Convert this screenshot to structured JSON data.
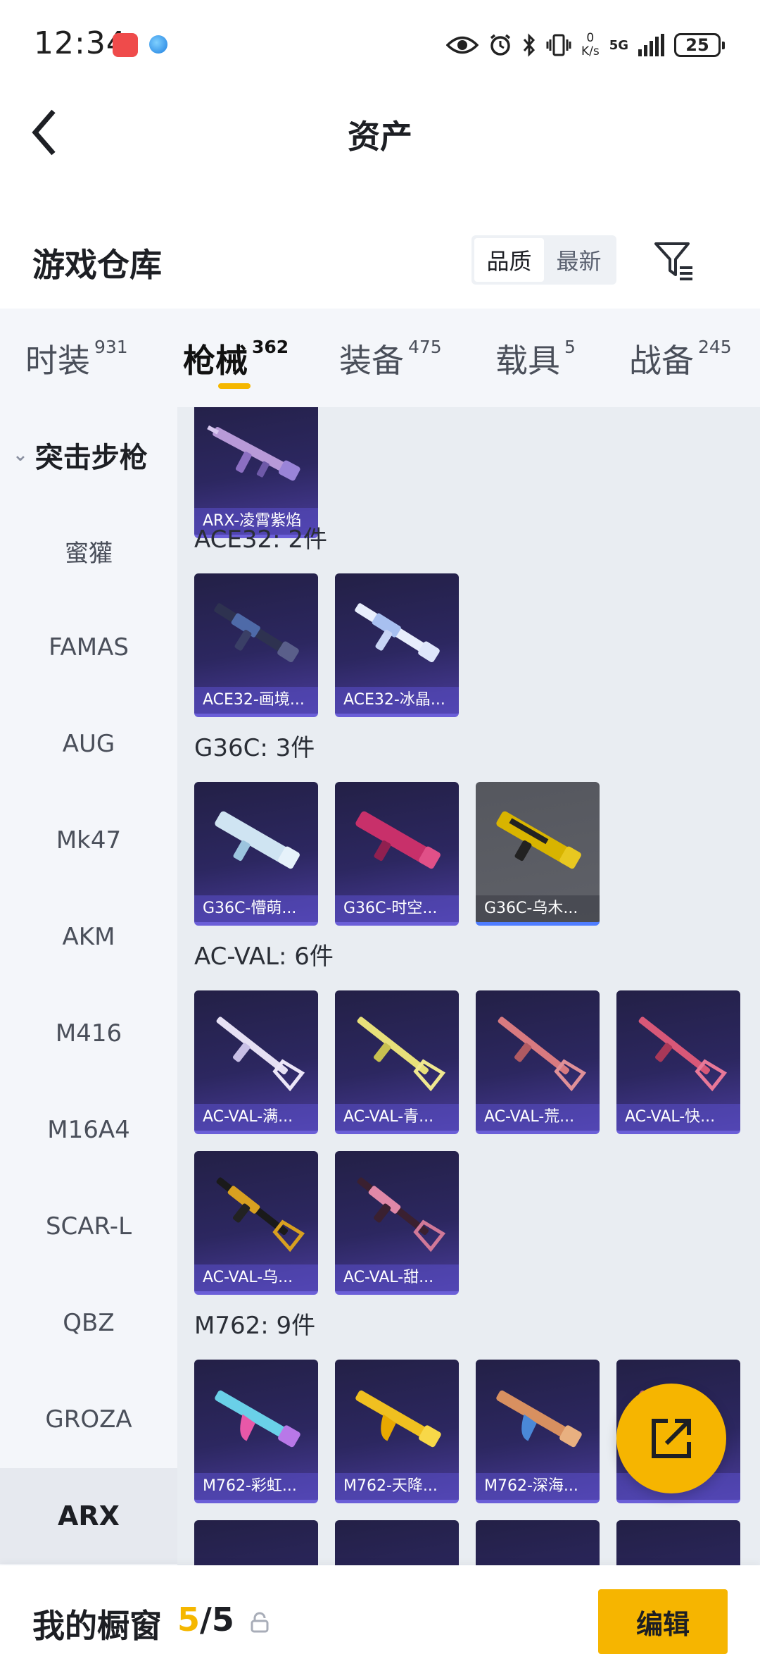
{
  "status_bar": {
    "time": "12:34",
    "net_speed_value": "0",
    "net_speed_unit": "K/s",
    "network": "5G",
    "battery": "25"
  },
  "header": {
    "title": "资产",
    "back_icon": "chevron-left-icon"
  },
  "warehouse": {
    "title": "游戏仓库",
    "sort_options": [
      "品质",
      "最新"
    ],
    "sort_selected": "品质",
    "filter_icon": "filter-icon"
  },
  "tabs": [
    {
      "label": "时装",
      "count": "931"
    },
    {
      "label": "枪械",
      "count": "362",
      "active": true
    },
    {
      "label": "装备",
      "count": "475"
    },
    {
      "label": "载具",
      "count": "5"
    },
    {
      "label": "战备",
      "count": "245"
    }
  ],
  "sidebar": {
    "group": "突击步枪",
    "items": [
      "蜜獾",
      "FAMAS",
      "AUG",
      "Mk47",
      "AKM",
      "M416",
      "M16A4",
      "SCAR-L",
      "QBZ",
      "GROZA",
      "ARX"
    ],
    "selected": "ARX"
  },
  "sections": [
    {
      "title": "",
      "items": [
        {
          "label": "ARX-凌霄紫焰"
        }
      ]
    },
    {
      "title": "ACE32: 2件",
      "items": [
        {
          "label": "ACE32-画境..."
        },
        {
          "label": "ACE32-冰晶..."
        }
      ]
    },
    {
      "title": "G36C: 3件",
      "items": [
        {
          "label": "G36C-懵萌..."
        },
        {
          "label": "G36C-时空..."
        },
        {
          "label": "G36C-乌木..."
        }
      ]
    },
    {
      "title": "AC-VAL: 6件",
      "items": [
        {
          "label": "AC-VAL-满..."
        },
        {
          "label": "AC-VAL-青..."
        },
        {
          "label": "AC-VAL-荒..."
        },
        {
          "label": "AC-VAL-快..."
        },
        {
          "label": "AC-VAL-乌..."
        },
        {
          "label": "AC-VAL-甜..."
        }
      ]
    },
    {
      "title": "M762: 9件",
      "items": [
        {
          "label": "M762-彩虹..."
        },
        {
          "label": "M762-天降..."
        },
        {
          "label": "M762-深海..."
        },
        {
          "label": ""
        }
      ]
    }
  ],
  "fab_icon": "share-external-icon",
  "bottom": {
    "showcase_label": "我的橱窗",
    "showcase_current": "5",
    "showcase_total": "/5",
    "lock_icon": "lock-icon",
    "edit_label": "编辑"
  },
  "colors": {
    "accent": "#f6b500",
    "card_bg": "#2c2760",
    "card_border": "#6b5fd8"
  }
}
